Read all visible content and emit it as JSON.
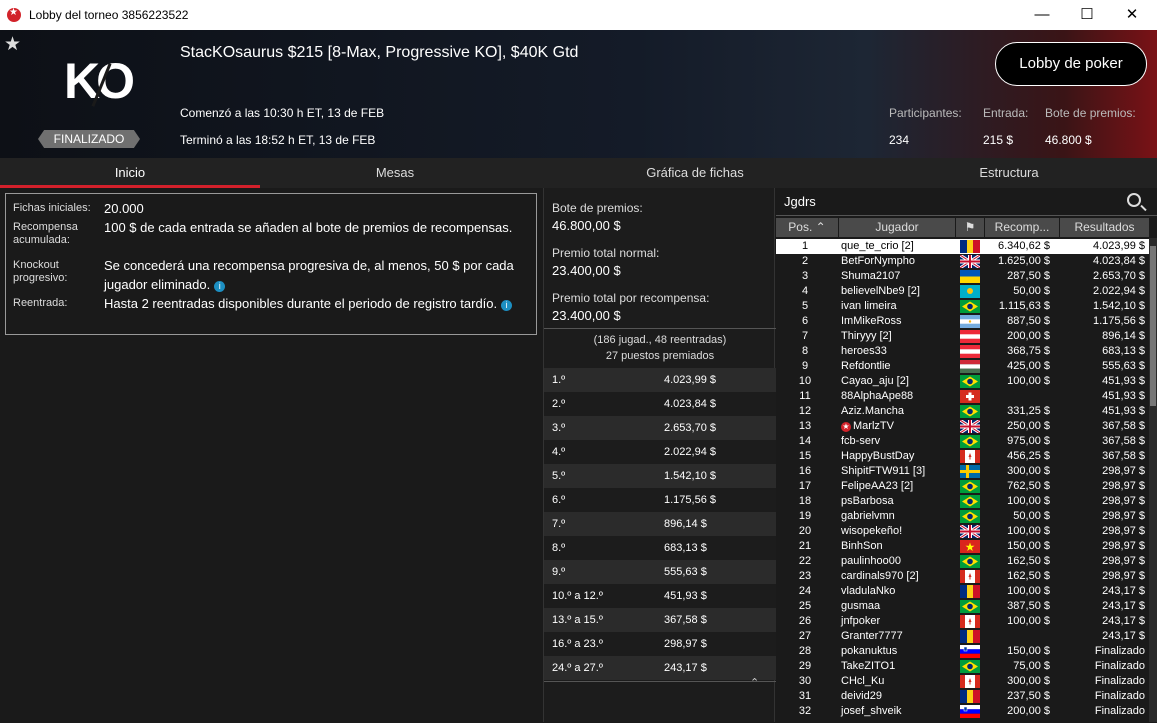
{
  "window": {
    "title": "Lobby del torneo 3856223522"
  },
  "header": {
    "tournament_name": "StacKOsaurus $215 [8-Max, Progressive KO], $40K Gtd",
    "logo_text": "KO",
    "status_badge": "FINALIZADO",
    "started": "Comenzó a las 10:30 h ET, 13 de FEB",
    "ended": "Terminó a las 18:52 h ET, 13 de FEB",
    "lobby_button": "Lobby de poker",
    "stats": [
      {
        "label": "Participantes:",
        "value": "234"
      },
      {
        "label": "Entrada:",
        "value": "215 $"
      },
      {
        "label": "Bote de premios:",
        "value": "46.800 $"
      }
    ]
  },
  "tabs": [
    {
      "label": "Inicio",
      "active": true
    },
    {
      "label": "Mesas"
    },
    {
      "label": "Gráfica de fichas"
    },
    {
      "label": "Estructura"
    }
  ],
  "info": {
    "rows": [
      {
        "label": "Fichas iniciales:",
        "value": "20.000"
      },
      {
        "label": "Recompensa acumulada:",
        "value": "100 $ de cada entrada se añaden al bote de premios de recompensas."
      },
      {
        "label": "Knockout progresivo:",
        "value": "Se concederá una recompensa progresiva de, al menos, 50 $ por cada jugador eliminado."
      },
      {
        "label": "Reentrada:",
        "value": "Hasta 2 reentradas disponibles durante el periodo de registro tardío."
      }
    ]
  },
  "prize": {
    "pool_label": "Bote de premios:",
    "pool_value": "46.800,00 $",
    "normal_label": "Premio total normal:",
    "normal_value": "23.400,00 $",
    "bounty_label": "Premio total por recompensa:",
    "bounty_value": "23.400,00 $",
    "entries": "(186 jugad., 48 reentradas)",
    "paid": "27 puestos premiados",
    "places": [
      {
        "place": "1.º",
        "amount": "4.023,99 $"
      },
      {
        "place": "2.º",
        "amount": "4.023,84 $"
      },
      {
        "place": "3.º",
        "amount": "2.653,70 $"
      },
      {
        "place": "4.º",
        "amount": "2.022,94 $"
      },
      {
        "place": "5.º",
        "amount": "1.542,10 $"
      },
      {
        "place": "6.º",
        "amount": "1.175,56 $"
      },
      {
        "place": "7.º",
        "amount": "896,14 $"
      },
      {
        "place": "8.º",
        "amount": "683,13 $"
      },
      {
        "place": "9.º",
        "amount": "555,63 $"
      },
      {
        "place": "10.º a 12.º",
        "amount": "451,93 $"
      },
      {
        "place": "13.º a 15.º",
        "amount": "367,58 $"
      },
      {
        "place": "16.º a 23.º",
        "amount": "298,97 $"
      },
      {
        "place": "24.º a 27.º",
        "amount": "243,17 $"
      }
    ]
  },
  "players": {
    "search_value": "Jgdrs",
    "columns": [
      "Pos.",
      "Jugador",
      "Recomp...",
      "Resultados"
    ],
    "rows": [
      {
        "pos": "1",
        "name": "que_te_crio [2]",
        "flag": "ro",
        "bounty": "6.340,62 $",
        "result": "4.023,99 $"
      },
      {
        "pos": "2",
        "name": "BetForNympho",
        "flag": "gb",
        "bounty": "1.625,00 $",
        "result": "4.023,84 $"
      },
      {
        "pos": "3",
        "name": "Shuma2107",
        "flag": "ua",
        "bounty": "287,50 $",
        "result": "2.653,70 $"
      },
      {
        "pos": "4",
        "name": "believelNbe9 [2]",
        "flag": "kz",
        "bounty": "50,00 $",
        "result": "2.022,94 $"
      },
      {
        "pos": "5",
        "name": "ivan limeira",
        "flag": "br",
        "bounty": "1.115,63 $",
        "result": "1.542,10 $"
      },
      {
        "pos": "6",
        "name": "ImMikeRoss",
        "flag": "ar",
        "bounty": "887,50 $",
        "result": "1.175,56 $"
      },
      {
        "pos": "7",
        "name": "Thiryyy [2]",
        "flag": "at",
        "bounty": "200,00 $",
        "result": "896,14 $"
      },
      {
        "pos": "8",
        "name": "heroes33",
        "flag": "at",
        "bounty": "368,75 $",
        "result": "683,13 $"
      },
      {
        "pos": "9",
        "name": "Refdontlie",
        "flag": "hu",
        "bounty": "425,00 $",
        "result": "555,63 $"
      },
      {
        "pos": "10",
        "name": "Cayao_aju [2]",
        "flag": "br",
        "bounty": "100,00 $",
        "result": "451,93 $"
      },
      {
        "pos": "11",
        "name": "88AlphaApe88",
        "flag": "ch",
        "bounty": "",
        "result": "451,93 $"
      },
      {
        "pos": "12",
        "name": "Aziz.Mancha",
        "flag": "br",
        "bounty": "331,25 $",
        "result": "451,93 $"
      },
      {
        "pos": "13",
        "name": "MarlzTV",
        "flag": "gb",
        "bounty": "250,00 $",
        "result": "367,58 $",
        "star": true
      },
      {
        "pos": "14",
        "name": "fcb-serv",
        "flag": "br",
        "bounty": "975,00 $",
        "result": "367,58 $"
      },
      {
        "pos": "15",
        "name": "HappyBustDay",
        "flag": "ca",
        "bounty": "456,25 $",
        "result": "367,58 $"
      },
      {
        "pos": "16",
        "name": "ShipitFTW911 [3]",
        "flag": "se",
        "bounty": "300,00 $",
        "result": "298,97 $"
      },
      {
        "pos": "17",
        "name": "FelipeAA23 [2]",
        "flag": "br",
        "bounty": "762,50 $",
        "result": "298,97 $"
      },
      {
        "pos": "18",
        "name": "psBarbosa",
        "flag": "br",
        "bounty": "100,00 $",
        "result": "298,97 $"
      },
      {
        "pos": "19",
        "name": "gabrielvmn",
        "flag": "br",
        "bounty": "50,00 $",
        "result": "298,97 $"
      },
      {
        "pos": "20",
        "name": "wisopekeño!",
        "flag": "gb",
        "bounty": "100,00 $",
        "result": "298,97 $"
      },
      {
        "pos": "21",
        "name": "BinhSon",
        "flag": "vn",
        "bounty": "150,00 $",
        "result": "298,97 $"
      },
      {
        "pos": "22",
        "name": "paulinhoo00",
        "flag": "br",
        "bounty": "162,50 $",
        "result": "298,97 $"
      },
      {
        "pos": "23",
        "name": "cardinals970 [2]",
        "flag": "ca",
        "bounty": "162,50 $",
        "result": "298,97 $"
      },
      {
        "pos": "24",
        "name": "vladulaNko",
        "flag": "ro",
        "bounty": "100,00 $",
        "result": "243,17 $"
      },
      {
        "pos": "25",
        "name": "gusmaa",
        "flag": "br",
        "bounty": "387,50 $",
        "result": "243,17 $"
      },
      {
        "pos": "26",
        "name": "jnfpoker",
        "flag": "ca",
        "bounty": "100,00 $",
        "result": "243,17 $"
      },
      {
        "pos": "27",
        "name": "Granter7777",
        "flag": "ro",
        "bounty": "",
        "result": "243,17 $"
      },
      {
        "pos": "28",
        "name": "pokanuktus",
        "flag": "si",
        "bounty": "150,00 $",
        "result": "Finalizado"
      },
      {
        "pos": "29",
        "name": "TakeZITO1",
        "flag": "br",
        "bounty": "75,00 $",
        "result": "Finalizado"
      },
      {
        "pos": "30",
        "name": "CHcl_Ku",
        "flag": "ca",
        "bounty": "300,00 $",
        "result": "Finalizado"
      },
      {
        "pos": "31",
        "name": "deivid29",
        "flag": "ro",
        "bounty": "237,50 $",
        "result": "Finalizado"
      },
      {
        "pos": "32",
        "name": "josef_shveik",
        "flag": "si",
        "bounty": "200,00 $",
        "result": "Finalizado"
      }
    ]
  }
}
